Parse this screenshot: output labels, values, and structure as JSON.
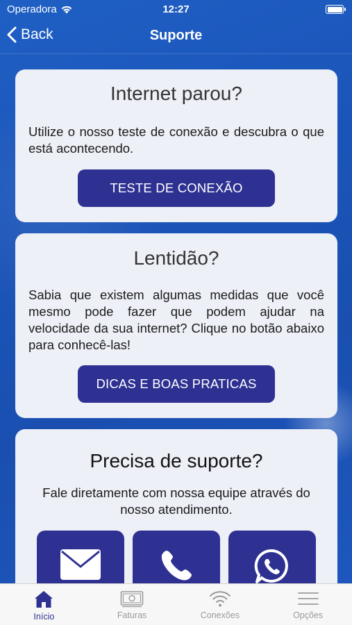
{
  "status_bar": {
    "carrier": "Operadora",
    "time": "12:27"
  },
  "nav": {
    "back_label": "Back",
    "title": "Suporte"
  },
  "cards": {
    "internet": {
      "title": "Internet parou?",
      "text": "Utilize o nosso teste de conexão e descubra o que está acontecendo.",
      "button": "TESTE DE CONEXÃO"
    },
    "slowness": {
      "title": "Lentidão?",
      "text": "Sabia que existem algumas medidas que você mesmo pode fazer que podem ajudar na velocidade da sua internet? Clique no botão abaixo para conhecê-las!",
      "button": "DICAS E BOAS PRATICAS"
    },
    "support": {
      "title": "Precisa de suporte?",
      "text": "Fale diretamente com nossa equipe através do nosso atendimento.",
      "contacts": [
        {
          "icon": "envelope-icon"
        },
        {
          "icon": "phone-icon"
        },
        {
          "icon": "whatsapp-icon"
        }
      ]
    }
  },
  "tabs": [
    {
      "label": "Início",
      "icon": "home-icon",
      "active": true
    },
    {
      "label": "Faturas",
      "icon": "banknote-icon",
      "active": false
    },
    {
      "label": "Conexões",
      "icon": "wifi-icon",
      "active": false
    },
    {
      "label": "Opções",
      "icon": "menu-icon",
      "active": false
    }
  ],
  "colors": {
    "brand": "#2e3192",
    "background": "#1b54b8",
    "card": "#eef0f7"
  }
}
